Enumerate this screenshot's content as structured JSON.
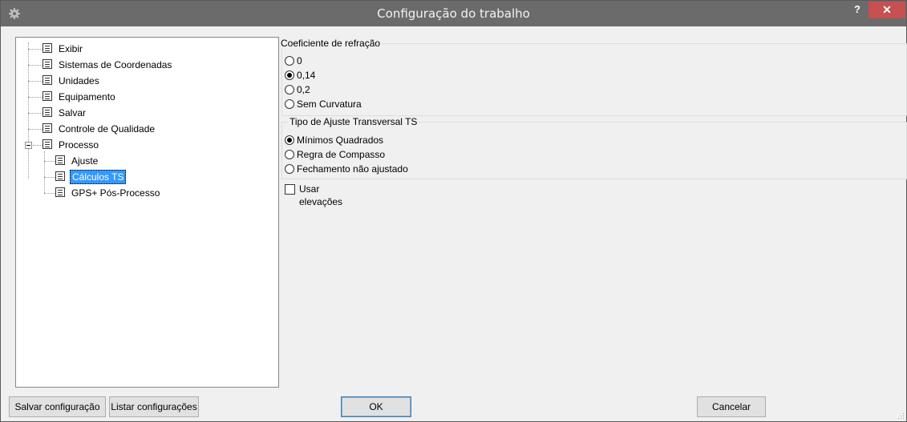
{
  "window": {
    "title": "Configuração do trabalho",
    "help_label": "?",
    "close_label": "✕"
  },
  "tree": {
    "items": [
      {
        "label": "Exibir"
      },
      {
        "label": "Sistemas de Coordenadas"
      },
      {
        "label": "Unidades"
      },
      {
        "label": "Equipamento"
      },
      {
        "label": "Salvar"
      },
      {
        "label": "Controle de Qualidade"
      },
      {
        "label": "Processo",
        "expanded": true
      },
      {
        "label": "Ajuste",
        "child": true
      },
      {
        "label": "Cálculos TS",
        "child": true,
        "selected": true
      },
      {
        "label": "GPS+ Pós-Processo",
        "child": true
      }
    ]
  },
  "refraction": {
    "title": "Coeficiente de refração",
    "options": [
      "0",
      "0,14",
      "0,2",
      "Sem Curvatura"
    ],
    "selected": "0,14"
  },
  "adjust_type": {
    "title": "Tipo de Ajuste Transversal TS",
    "options": [
      "Mínimos Quadrados",
      "Regra de Compasso",
      "Fechamento não ajustado"
    ],
    "selected": "Mínimos Quadrados"
  },
  "use_elevations": {
    "label": "Usar elevações",
    "checked": false
  },
  "buttons": {
    "save_config": "Salvar configuração",
    "list_configs": "Listar configurações",
    "ok": "OK",
    "cancel": "Cancelar"
  },
  "colors": {
    "titlebar": "#6b6b6b",
    "close": "#c75050",
    "selection": "#3399ff"
  }
}
